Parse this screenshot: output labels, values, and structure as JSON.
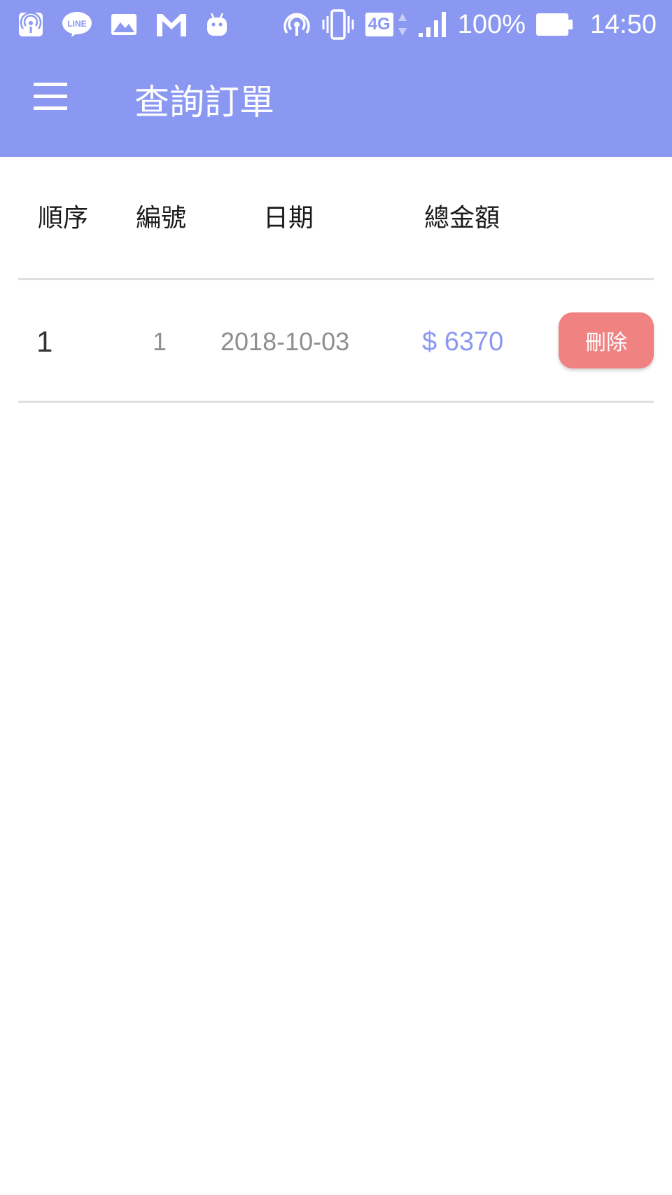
{
  "status_bar": {
    "left_icons": [
      "hotspot-icon",
      "line-icon",
      "gallery-icon",
      "gmail-icon",
      "android-icon"
    ],
    "right_icons": [
      "hotspot-icon",
      "vibrate-icon",
      "network-4g-icon",
      "signal-icon",
      "battery-icon"
    ],
    "network_type": "4G",
    "battery": "100%",
    "time": "14:50"
  },
  "app_bar": {
    "menu_icon": "menu-icon",
    "title": "查詢訂單"
  },
  "table": {
    "headers": [
      "順序",
      "編號",
      "日期",
      "總金額"
    ],
    "rows": [
      {
        "seq": "1",
        "id": "1",
        "date": "2018-10-03",
        "total": "$ 6370",
        "action_label": "刪除"
      }
    ]
  },
  "colors": {
    "primary": "#8A98F1",
    "delete_button": "#F08282",
    "amount_text": "#8A98F1",
    "muted_text": "#8f8f8f"
  }
}
